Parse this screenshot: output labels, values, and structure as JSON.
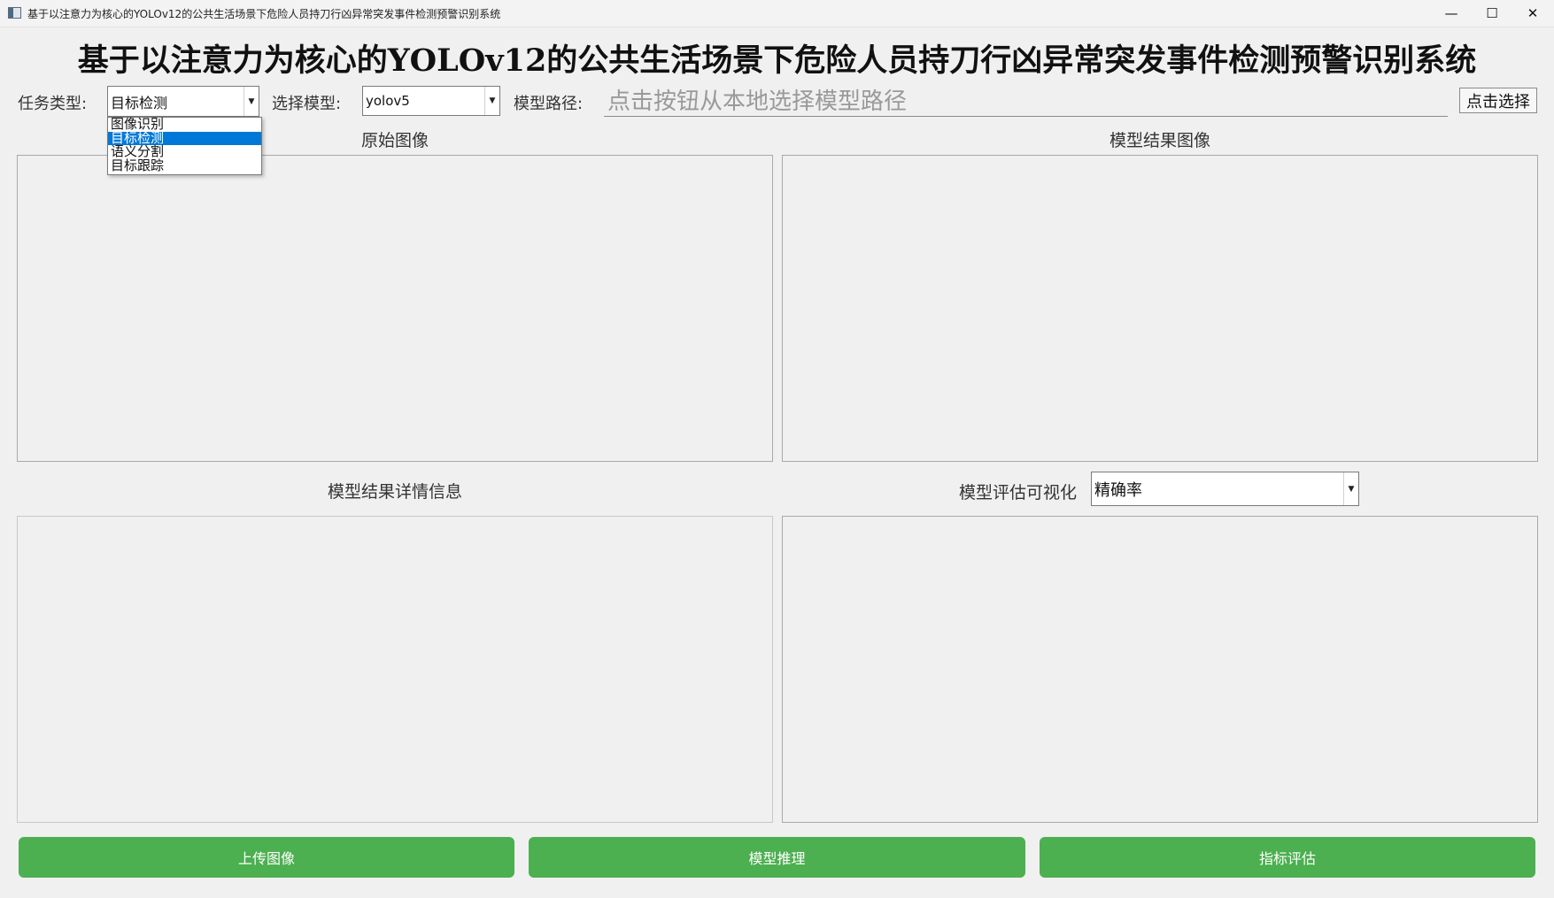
{
  "window": {
    "title": "基于以注意力为核心的YOLOv12的公共生活场景下危险人员持刀行凶异常突发事件检测预警识别系统",
    "minimize_glyph": "—",
    "maximize_glyph": "☐",
    "close_glyph": "✕"
  },
  "header": {
    "title": "基于以注意力为核心的YOLOv12的公共生活场景下危险人员持刀行凶异常突发事件检测预警识别系统"
  },
  "controls": {
    "task_label": "任务类型:",
    "task_value": "目标检测",
    "task_options": [
      "图像识别",
      "目标检测",
      "语义分割",
      "目标跟踪"
    ],
    "task_selected_index": 1,
    "model_label": "选择模型:",
    "model_value": "yolov5",
    "path_label": "模型路径:",
    "path_placeholder": "点击按钮从本地选择模型路径",
    "pick_button": "点击选择"
  },
  "panels": {
    "original_label": "原始图像",
    "result_label": "模型结果图像",
    "details_label": "模型结果详情信息",
    "eval_label": "模型评估可视化",
    "eval_metric_value": "精确率"
  },
  "actions": {
    "upload": "上传图像",
    "infer": "模型推理",
    "evaluate": "指标评估"
  },
  "colors": {
    "accent_green": "#4caf50",
    "selection_blue": "#0078d7"
  }
}
